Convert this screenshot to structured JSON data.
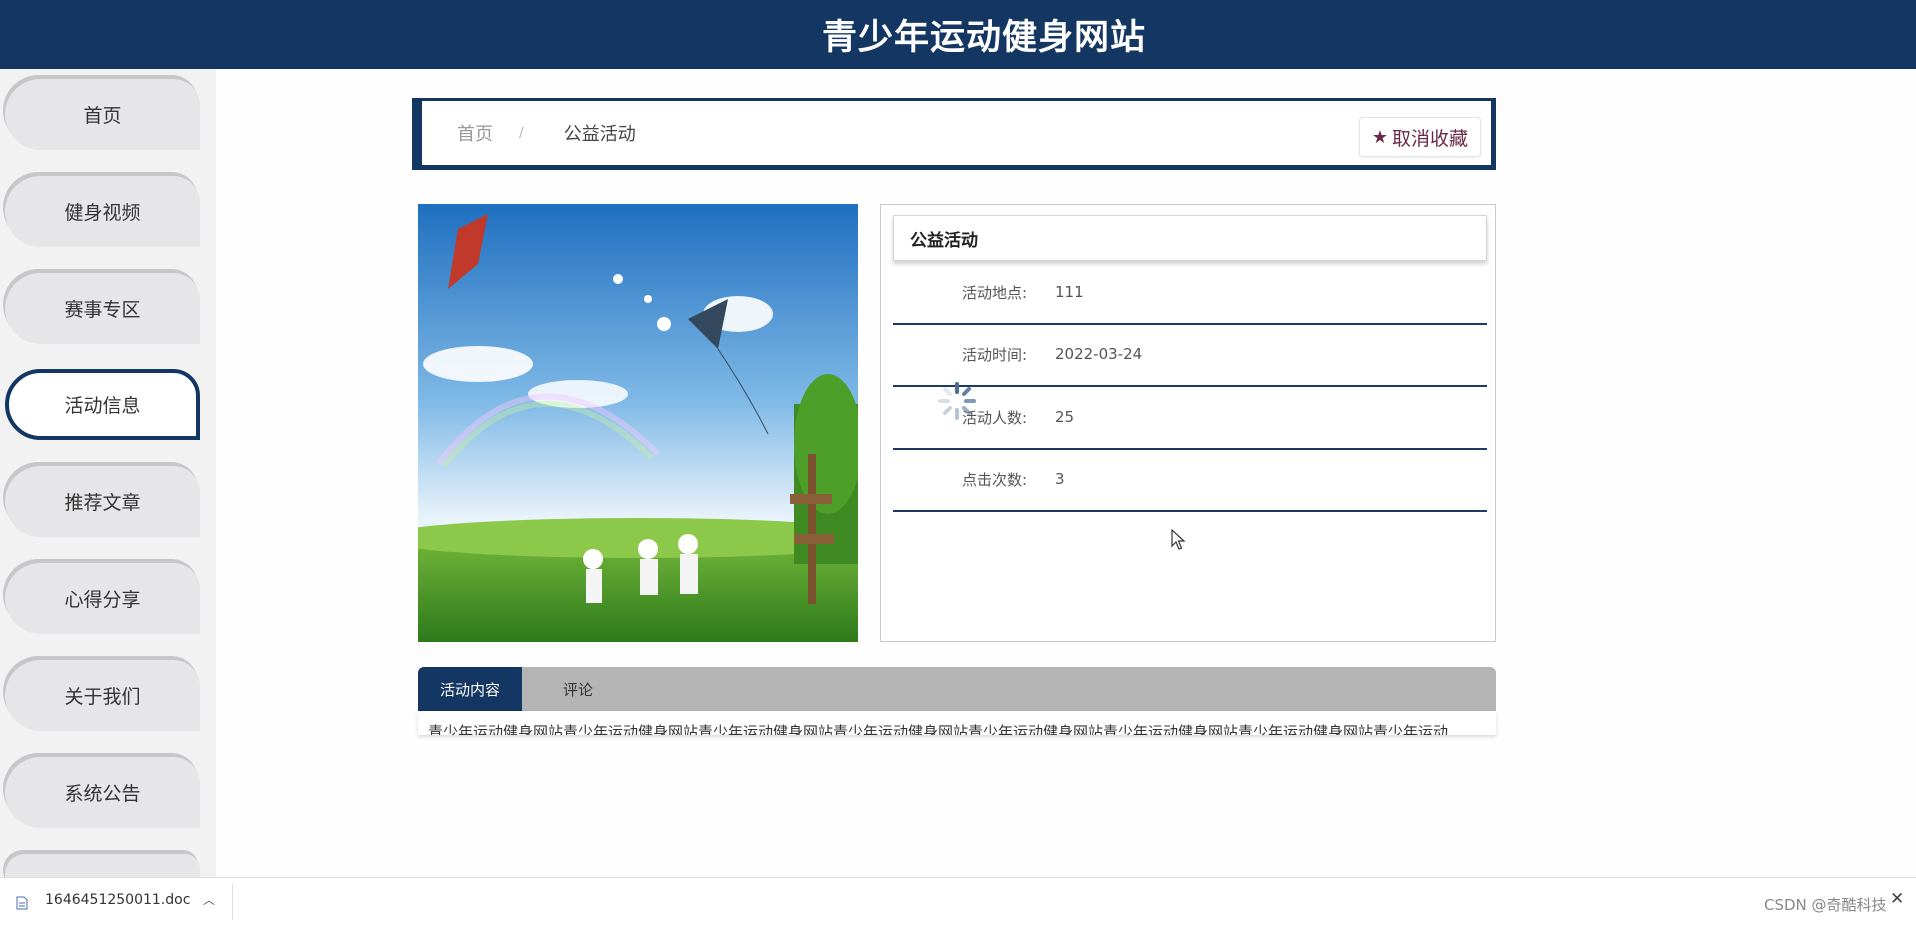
{
  "header": {
    "title": "青少年运动健身网站"
  },
  "sidebar": {
    "items": [
      {
        "label": "首页"
      },
      {
        "label": "健身视频"
      },
      {
        "label": "赛事专区"
      },
      {
        "label": "活动信息",
        "active": true
      },
      {
        "label": "推荐文章"
      },
      {
        "label": "心得分享"
      },
      {
        "label": "关于我们"
      },
      {
        "label": "系统公告"
      }
    ]
  },
  "breadcrumb": {
    "home": "首页",
    "separator": "/",
    "current": "公益活动"
  },
  "favorite_button": {
    "label": "取消收藏",
    "icon": "star-icon"
  },
  "info": {
    "title": "公益活动",
    "rows": [
      {
        "label": "活动地点:",
        "value": "111"
      },
      {
        "label": "活动时间:",
        "value": "2022-03-24"
      },
      {
        "label": "活动人数:",
        "value": "25"
      },
      {
        "label": "点击次数:",
        "value": "3"
      }
    ]
  },
  "tabs": {
    "content": "活动内容",
    "comments": "评论"
  },
  "content": {
    "text": "青少年运动健身网站青少年运动健身网站青少年运动健身网站青少年运动健身网站青少年运动健身网站青少年运动健身网站青少年运动健身网站青少年运动"
  },
  "download_bar": {
    "file_name": "1646451250011.doc",
    "watermark": "CSDN @奇酷科技"
  },
  "colors": {
    "primary": "#143662",
    "favorite": "#6b2a4a",
    "sidebar_bg": "#f3f2f3"
  }
}
